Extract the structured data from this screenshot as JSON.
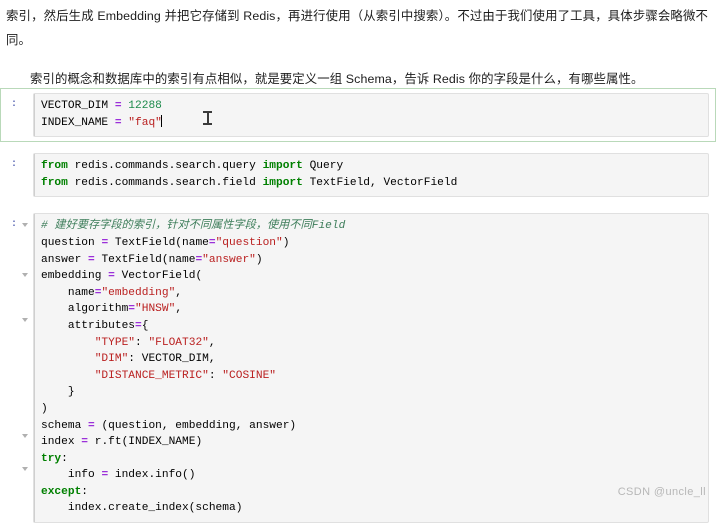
{
  "prose": {
    "paragraph_1": "索引，然后生成 Embedding 并把它存储到 Redis，再进行使用（从索引中搜索）。不过由于我们使用了工具，具体步骤会略微不同。",
    "paragraph_2": "索引的概念和数据库中的索引有点相似，就是要定义一组 Schema，告诉 Redis 你的字段是什么，有哪些属性。"
  },
  "notebook": {
    "cells": [
      {
        "prompt": ":",
        "selected": true,
        "lines": [
          "VECTOR_DIM = 12288",
          "INDEX_NAME = \"faq\""
        ]
      },
      {
        "prompt": ":",
        "selected": false,
        "lines": [
          "from redis.commands.search.query import Query",
          "from redis.commands.search.field import TextField, VectorField"
        ]
      },
      {
        "prompt": ":",
        "selected": false,
        "lines": [
          "# 建好要存字段的索引，针对不同属性字段，使用不同Field",
          "question = TextField(name=\"question\")",
          "answer = TextField(name=\"answer\")",
          "embedding = VectorField(",
          "    name=\"embedding\",",
          "    algorithm=\"HNSW\",",
          "    attributes={",
          "        \"TYPE\": \"FLOAT32\",",
          "        \"DIM\": VECTOR_DIM,",
          "        \"DISTANCE_METRIC\": \"COSINE\"",
          "    }",
          ")",
          "schema = (question, embedding, answer)",
          "index = r.ft(INDEX_NAME)",
          "try:",
          "    info = index.info()",
          "except:",
          "    index.create_index(schema)"
        ]
      }
    ]
  },
  "watermark": {
    "text": "CSDN @uncle_ll"
  },
  "colors": {
    "keyword": "#008000",
    "string": "#ba2121",
    "number": "#1c8a4b",
    "operator": "#9b30d9",
    "comment": "#3d7d5a",
    "prompt": "#303f9f",
    "selected_cell_border": "#b9d9b9",
    "code_background": "#f5f5f5"
  },
  "cursor": {
    "icon": "text-ibeam-cursor"
  }
}
